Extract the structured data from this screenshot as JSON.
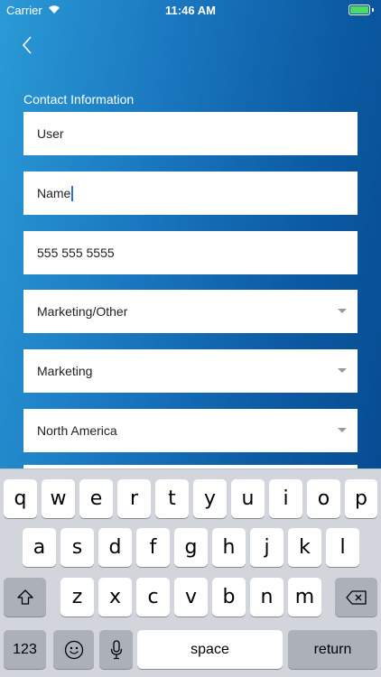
{
  "status_bar": {
    "carrier": "Carrier",
    "time": "11:46 AM",
    "wifi_icon": "wifi-icon",
    "battery_icon": "battery-icon",
    "battery_color": "#4cd964"
  },
  "nav": {
    "back_icon": "chevron-left-icon"
  },
  "form": {
    "section_title": "Contact Information",
    "fields": [
      {
        "type": "text",
        "value": "User"
      },
      {
        "type": "text",
        "value": "Name",
        "focused": true
      },
      {
        "type": "text",
        "value": "555 555 5555"
      },
      {
        "type": "dropdown",
        "value": "Marketing/Other"
      },
      {
        "type": "dropdown",
        "value": "Marketing"
      },
      {
        "type": "dropdown",
        "value": "North America"
      }
    ]
  },
  "keyboard": {
    "row1": [
      "q",
      "w",
      "e",
      "r",
      "t",
      "y",
      "u",
      "i",
      "o",
      "p"
    ],
    "row2": [
      "a",
      "s",
      "d",
      "f",
      "g",
      "h",
      "j",
      "k",
      "l"
    ],
    "row3": [
      "z",
      "x",
      "c",
      "v",
      "b",
      "n",
      "m"
    ],
    "shift_icon": "shift-icon",
    "delete_icon": "backspace-icon",
    "numbers_label": "123",
    "emoji_icon": "emoji-icon",
    "mic_icon": "microphone-icon",
    "space_label": "space",
    "return_label": "return"
  },
  "colors": {
    "gradient_light": "#2a9ad6",
    "gradient_dark": "#06488f",
    "caret": "#2f6ee6",
    "keyboard_bg": "#d2d5db"
  }
}
